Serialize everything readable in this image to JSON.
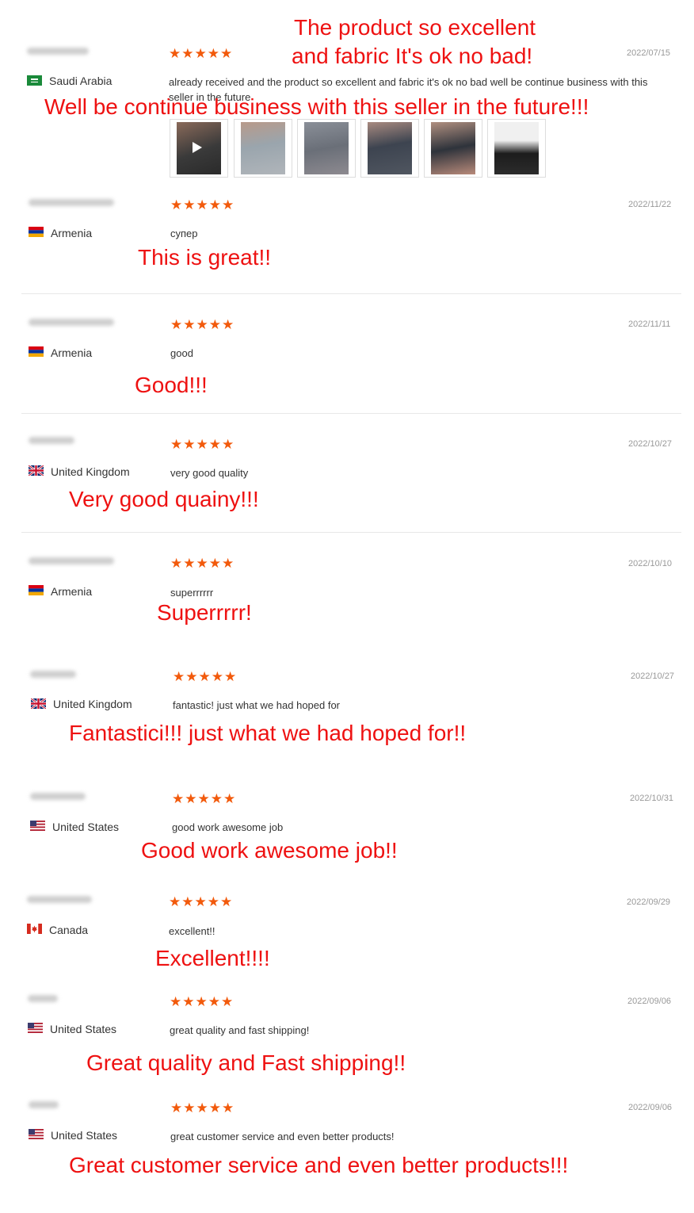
{
  "colors": {
    "stars": "#f25a0c",
    "overlay_text": "#ee1111",
    "date": "#999999"
  },
  "reviews": [
    {
      "country": "Saudi Arabia",
      "flag_icon": "saudi-arabia-flag-icon",
      "stars": "★★★★★",
      "rating": 5,
      "date": "2022/07/15",
      "text": "already received and the product so excellent and fabric it's ok no bad well be continue business with this seller in the future",
      "overlay_lines": [
        "The product so excellent",
        "and fabric It's ok no bad!",
        "Well be continue business with this seller in the future!!!"
      ],
      "photos": [
        "video-thumbnail",
        "photo-2",
        "photo-3",
        "photo-4",
        "photo-5",
        "photo-6"
      ]
    },
    {
      "country": "Armenia",
      "flag_icon": "armenia-flag-icon",
      "stars": "★★★★★",
      "rating": 5,
      "date": "2022/11/22",
      "text": "супер",
      "overlay": "This is great!!"
    },
    {
      "country": "Armenia",
      "flag_icon": "armenia-flag-icon",
      "stars": "★★★★★",
      "rating": 5,
      "date": "2022/11/11",
      "text": "good",
      "overlay": "Good!!!"
    },
    {
      "country": "United Kingdom",
      "flag_icon": "uk-flag-icon",
      "stars": "★★★★★",
      "rating": 5,
      "date": "2022/10/27",
      "text": "very good quality",
      "overlay": "Very good quainy!!!"
    },
    {
      "country": "Armenia",
      "flag_icon": "armenia-flag-icon",
      "stars": "★★★★★",
      "rating": 5,
      "date": "2022/10/10",
      "text": "superrrrrr",
      "overlay": "Superrrrr!"
    },
    {
      "country": "United Kingdom",
      "flag_icon": "uk-flag-icon",
      "stars": "★★★★★",
      "rating": 5,
      "date": "2022/10/27",
      "text": "fantastic! just what we had hoped for",
      "overlay": "Fantastici!!! just what we had hoped for!!"
    },
    {
      "country": "United States",
      "flag_icon": "us-flag-icon",
      "stars": "★★★★★",
      "rating": 5,
      "date": "2022/10/31",
      "text": "good work awesome job",
      "overlay": "Good work awesome job!!"
    },
    {
      "country": "Canada",
      "flag_icon": "canada-flag-icon",
      "stars": "★★★★★",
      "rating": 5,
      "date": "2022/09/29",
      "text": "excellent!!",
      "overlay": "Excellent!!!!"
    },
    {
      "country": "United States",
      "flag_icon": "us-flag-icon",
      "stars": "★★★★★",
      "rating": 5,
      "date": "2022/09/06",
      "text": "great quality and fast shipping!",
      "overlay": "Great quality and Fast shipping!!"
    },
    {
      "country": "United States",
      "flag_icon": "us-flag-icon",
      "stars": "★★★★★",
      "rating": 5,
      "date": "2022/09/06",
      "text": "great customer service and even better products!",
      "overlay": "Great customer service and even better products!!!"
    }
  ]
}
